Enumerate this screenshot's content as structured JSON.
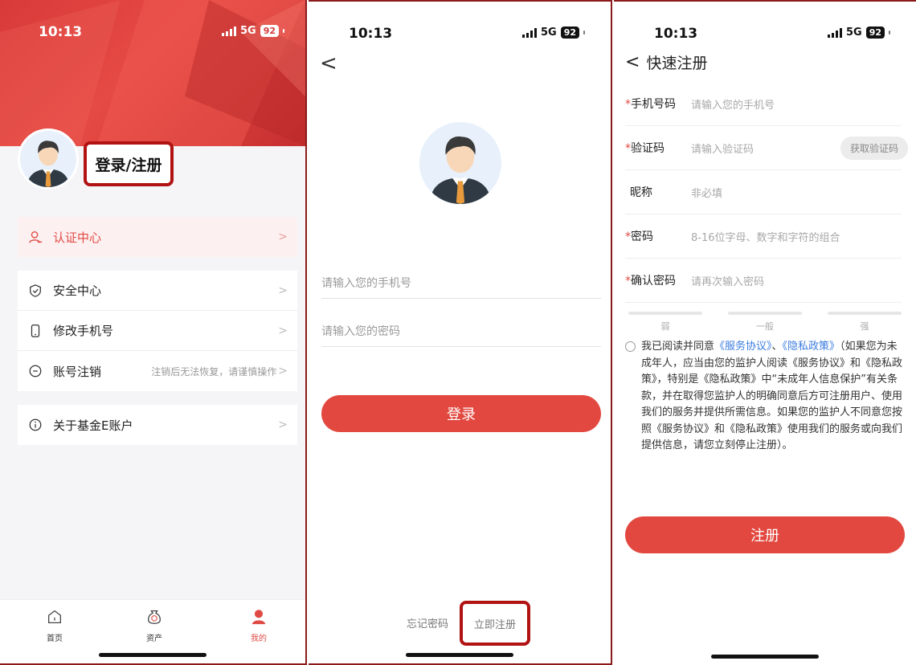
{
  "status": {
    "time": "10:13",
    "network": "5G",
    "battery": "92"
  },
  "profile_screen": {
    "login_register": "登录/注册",
    "auth_item": "认证中心",
    "menu": [
      {
        "label": "安全中心",
        "icon": "shield-check-icon"
      },
      {
        "label": "修改手机号",
        "icon": "phone-icon"
      },
      {
        "label": "账号注销",
        "icon": "minus-circle-icon",
        "hint": "注销后无法恢复，请谨慎操作"
      }
    ],
    "about": "关于基金E账户",
    "chevron": ">",
    "tabs": [
      {
        "label": "首页",
        "icon": "home-icon"
      },
      {
        "label": "资产",
        "icon": "money-bag-icon"
      },
      {
        "label": "我的",
        "icon": "person-icon"
      }
    ],
    "colors": {
      "brand_red": "#e04a44",
      "accent_frame": "#b11212"
    }
  },
  "login_screen": {
    "back": "<",
    "phone_placeholder": "请输入您的手机号",
    "password_placeholder": "请输入您的密码",
    "login_button": "登录",
    "forgot_password": "忘记密码",
    "register_now": "立即注册"
  },
  "register_screen": {
    "back": "<",
    "title": "快速注册",
    "required_mark": "*",
    "fields": [
      {
        "label": "手机号码",
        "placeholder": "请输入您的手机号"
      },
      {
        "label": "验证码",
        "placeholder": "请输入验证码"
      },
      {
        "label": "昵称",
        "placeholder": "非必填"
      },
      {
        "label": "密码",
        "placeholder": "8-16位字母、数字和字符的组合"
      },
      {
        "label": "确认密码",
        "placeholder": "请再次输入密码"
      }
    ],
    "get_code": "获取验证码",
    "strength": [
      "弱",
      "一般",
      "强"
    ],
    "agreement": {
      "prefix": "我已阅读并同意",
      "service_link": "《服务协议》",
      "sep": "、",
      "privacy_link": "《隐私政策》",
      "body": "（如果您为未成年人，应当由您的监护人阅读《服务协议》和《隐私政策》，特别是《隐私政策》中“未成年人信息保护”有关条款，并在取得您监护人的明确同意后方可注册用户、使用我们的服务并提供所需信息。如果您的监护人不同意您按照《服务协议》和《隐私政策》使用我们的服务或向我们提供信息，请您立刻停止注册）。"
    },
    "register_button": "注册"
  }
}
